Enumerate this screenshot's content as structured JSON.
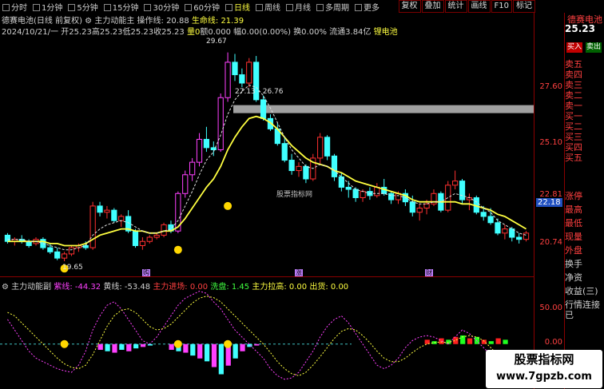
{
  "toolbar": {
    "items": [
      {
        "label": "分时",
        "active": false
      },
      {
        "label": "1分钟",
        "active": false
      },
      {
        "label": "5分钟",
        "active": false
      },
      {
        "label": "15分钟",
        "active": false
      },
      {
        "label": "30分钟",
        "active": false
      },
      {
        "label": "60分钟",
        "active": false
      },
      {
        "label": "日线",
        "active": true
      },
      {
        "label": "周线",
        "active": false
      },
      {
        "label": "月线",
        "active": false
      },
      {
        "label": "多周期",
        "active": false
      },
      {
        "label": "更多",
        "active": false
      }
    ],
    "right_buttons": [
      "复权",
      "叠加",
      "统计",
      "画线",
      "F10",
      "标记"
    ]
  },
  "main_title": {
    "stock": "德赛电池(日线 前复权)",
    "indicator": "主力动能主",
    "op_label": "操作线: 20.88",
    "life_label": "生命线: 21.39"
  },
  "info_line": {
    "date": "2024/10/21/一",
    "open": "开25.23",
    "high": "高25.23",
    "low": "低25.23",
    "close": "收25.23",
    "vol": "量0",
    "amount": "额0.000",
    "pct": "幅0.00(0.00%)",
    "turnover": "换0.00%",
    "float": "流通3.84亿",
    "sector": "锂电池"
  },
  "price_axis": {
    "labels": [
      "27.60",
      "25.10",
      "22.81",
      "20.74"
    ],
    "current": "22.18",
    "sub_labels": [
      "50.00",
      "0.00"
    ]
  },
  "annotations": {
    "high": "29.67",
    "low": "19.65",
    "range": "27.13 - 26.76",
    "watermark": "股票指标网",
    "mark1": "购",
    "mark2": "涨",
    "mark3": "财"
  },
  "sub_panel": {
    "name": "主力动能副",
    "purple": "紫线: -44.32",
    "yellow": "黄线: -53.48",
    "enter": "主力进场: 0.00",
    "wash": "洗盘: 1.45",
    "pull": "主力拉高: 0.00",
    "exit": "出货: 0.00"
  },
  "side_panel": {
    "stock_name": "德赛电池",
    "price": "25.23",
    "buy": "买入",
    "sell": "卖出",
    "order_labels": [
      "卖五",
      "卖四",
      "卖三",
      "卖二",
      "卖一",
      "买一",
      "买二",
      "买三",
      "买四",
      "买五"
    ],
    "stat_labels": [
      "涨停",
      "最高",
      "最低",
      "现量",
      "外盘",
      "换手",
      "净资",
      "收益(三)",
      "行情连接已"
    ]
  },
  "logo": {
    "line1": "股票指标网",
    "line2": "www.7gpzb.com"
  },
  "colors": {
    "up": "#ff3030",
    "down": "#40ffff",
    "line_yellow": "#ffff40",
    "frame": "#8b0000",
    "purple_bar": "#ff40ff"
  },
  "chart_data": {
    "type": "candlestick",
    "y_range": [
      19.0,
      30.5
    ],
    "candles": [
      [
        20.9,
        21.0,
        20.5,
        20.6
      ],
      [
        20.6,
        20.8,
        20.4,
        20.7
      ],
      [
        20.7,
        20.9,
        20.5,
        20.6
      ],
      [
        20.6,
        20.7,
        20.3,
        20.4
      ],
      [
        20.5,
        20.8,
        20.4,
        20.7
      ],
      [
        20.7,
        20.8,
        20.2,
        20.3
      ],
      [
        20.3,
        20.5,
        20.0,
        20.1
      ],
      [
        20.1,
        20.3,
        19.7,
        19.8
      ],
      [
        19.8,
        20.1,
        19.65,
        20.0
      ],
      [
        20.0,
        20.4,
        19.9,
        20.3
      ],
      [
        20.3,
        20.5,
        20.1,
        20.4
      ],
      [
        20.4,
        20.6,
        20.2,
        20.3
      ],
      [
        20.3,
        22.5,
        20.2,
        22.3
      ],
      [
        22.3,
        22.5,
        21.8,
        22.0
      ],
      [
        22.0,
        22.3,
        21.7,
        22.1
      ],
      [
        22.1,
        22.2,
        21.5,
        21.6
      ],
      [
        21.6,
        21.9,
        21.3,
        21.8
      ],
      [
        21.8,
        22.1,
        21.0,
        21.1
      ],
      [
        21.1,
        21.2,
        20.3,
        20.4
      ],
      [
        20.4,
        20.8,
        20.2,
        20.6
      ],
      [
        20.6,
        20.9,
        20.5,
        20.8
      ],
      [
        20.8,
        21.0,
        20.7,
        20.9
      ],
      [
        20.9,
        21.5,
        20.8,
        21.4
      ],
      [
        21.4,
        21.6,
        21.0,
        21.1
      ],
      [
        21.1,
        23.0,
        21.0,
        22.9
      ],
      [
        22.9,
        24.0,
        22.7,
        23.8
      ],
      [
        23.8,
        24.6,
        23.5,
        24.4
      ],
      [
        24.4,
        25.8,
        24.2,
        25.5
      ],
      [
        25.5,
        26.1,
        24.9,
        25.1
      ],
      [
        25.1,
        25.4,
        24.7,
        25.0
      ],
      [
        25.0,
        27.7,
        24.9,
        27.5
      ],
      [
        27.5,
        29.67,
        27.3,
        29.2
      ],
      [
        29.2,
        29.6,
        28.3,
        28.6
      ],
      [
        28.6,
        28.9,
        28.0,
        28.2
      ],
      [
        28.2,
        29.4,
        28.0,
        29.2
      ],
      [
        29.2,
        29.5,
        27.3,
        27.4
      ],
      [
        27.4,
        27.6,
        26.4,
        26.5
      ],
      [
        26.5,
        26.7,
        25.9,
        26.0
      ],
      [
        26.0,
        26.3,
        25.2,
        25.3
      ],
      [
        25.3,
        25.6,
        24.4,
        24.5
      ],
      [
        24.5,
        24.8,
        23.8,
        24.0
      ],
      [
        24.0,
        24.4,
        23.7,
        24.2
      ],
      [
        24.2,
        24.3,
        23.4,
        23.6
      ],
      [
        23.6,
        24.8,
        23.5,
        24.6
      ],
      [
        24.6,
        25.8,
        24.3,
        25.6
      ],
      [
        25.6,
        25.7,
        24.5,
        24.7
      ],
      [
        24.7,
        24.8,
        23.5,
        23.7
      ],
      [
        23.7,
        23.9,
        23.0,
        23.2
      ],
      [
        23.2,
        23.5,
        22.7,
        23.1
      ],
      [
        23.1,
        23.2,
        22.5,
        22.7
      ],
      [
        22.7,
        23.1,
        22.5,
        23.0
      ],
      [
        23.0,
        23.2,
        22.6,
        22.8
      ],
      [
        22.8,
        23.4,
        22.7,
        23.2
      ],
      [
        23.2,
        23.6,
        22.8,
        22.9
      ],
      [
        22.9,
        23.0,
        22.4,
        22.6
      ],
      [
        22.6,
        23.0,
        22.4,
        22.9
      ],
      [
        22.9,
        23.1,
        22.3,
        22.5
      ],
      [
        22.5,
        22.8,
        21.8,
        22.0
      ],
      [
        22.0,
        22.4,
        21.6,
        22.2
      ],
      [
        22.2,
        22.6,
        21.9,
        22.4
      ],
      [
        22.4,
        23.1,
        22.3,
        22.9
      ],
      [
        22.9,
        23.0,
        22.0,
        22.1
      ],
      [
        22.1,
        23.5,
        22.0,
        23.3
      ],
      [
        23.3,
        24.0,
        23.1,
        23.5
      ],
      [
        23.5,
        23.6,
        22.4,
        22.6
      ],
      [
        22.6,
        22.9,
        22.1,
        22.7
      ],
      [
        22.7,
        22.8,
        21.9,
        22.0
      ],
      [
        22.0,
        22.3,
        21.6,
        21.8
      ],
      [
        21.8,
        22.2,
        21.4,
        21.5
      ],
      [
        21.5,
        21.7,
        20.9,
        21.0
      ],
      [
        21.0,
        21.4,
        20.7,
        21.2
      ],
      [
        21.2,
        21.3,
        20.6,
        20.8
      ],
      [
        20.8,
        21.0,
        20.5,
        20.7
      ],
      [
        20.7,
        21.1,
        20.6,
        21.0
      ]
    ],
    "yellow_line": [
      20.6,
      20.6,
      20.6,
      20.6,
      20.6,
      20.6,
      20.5,
      20.5,
      20.4,
      20.4,
      20.4,
      20.5,
      20.7,
      20.9,
      21.0,
      21.1,
      21.2,
      21.2,
      21.1,
      21.1,
      21.0,
      21.0,
      21.1,
      21.1,
      21.3,
      21.7,
      22.2,
      22.7,
      23.2,
      23.6,
      24.2,
      25.0,
      25.6,
      26.1,
      26.5,
      26.6,
      26.5,
      26.3,
      26.0,
      25.6,
      25.2,
      24.9,
      24.6,
      24.4,
      24.3,
      24.2,
      24.0,
      23.9,
      23.7,
      23.5,
      23.4,
      23.3,
      23.2,
      23.1,
      23.0,
      22.9,
      22.8,
      22.6,
      22.5,
      22.5,
      22.5,
      22.5,
      22.5,
      22.5,
      22.4,
      22.4,
      22.3,
      22.2,
      22.1,
      21.9,
      21.8,
      21.6,
      21.4,
      21.2
    ],
    "white_dashed": [
      20.7,
      20.7,
      20.7,
      20.6,
      20.6,
      20.5,
      20.4,
      20.3,
      20.2,
      20.2,
      20.3,
      20.4,
      20.9,
      21.2,
      21.4,
      21.5,
      21.6,
      21.5,
      21.3,
      21.1,
      21.0,
      21.0,
      21.1,
      21.2,
      21.6,
      22.3,
      23.0,
      23.8,
      24.5,
      24.9,
      25.7,
      26.7,
      27.4,
      27.8,
      28.1,
      28.0,
      27.6,
      27.0,
      26.3,
      25.6,
      25.0,
      24.6,
      24.2,
      24.1,
      24.3,
      24.2,
      24.0,
      23.7,
      23.4,
      23.1,
      23.0,
      22.9,
      22.9,
      22.9,
      22.8,
      22.8,
      22.7,
      22.5,
      22.4,
      22.4,
      22.5,
      22.5,
      22.7,
      22.9,
      22.8,
      22.7,
      22.5,
      22.2,
      22.0,
      21.6,
      21.4,
      21.2,
      21.0,
      20.9
    ],
    "sub_purple": [
      35,
      20,
      5,
      -10,
      -20,
      -25,
      -30,
      -35,
      -38,
      -40,
      -30,
      -10,
      20,
      40,
      55,
      60,
      50,
      35,
      20,
      5,
      0,
      10,
      25,
      40,
      55,
      65,
      70,
      75,
      72,
      60,
      50,
      35,
      20,
      10,
      0,
      -10,
      -20,
      -35,
      -45,
      -50,
      -48,
      -40,
      -25,
      -10,
      10,
      25,
      35,
      40,
      30,
      15,
      0,
      -15,
      -30,
      -35,
      -30,
      -20,
      -5,
      5,
      10,
      12,
      10,
      5,
      0,
      10,
      20,
      15,
      5,
      -5,
      -15,
      -25,
      -30,
      -35,
      -40,
      -44
    ],
    "sub_yellow": [
      45,
      40,
      30,
      20,
      10,
      0,
      -10,
      -20,
      -28,
      -33,
      -35,
      -30,
      -15,
      5,
      25,
      40,
      48,
      50,
      45,
      35,
      25,
      20,
      22,
      28,
      38,
      48,
      58,
      65,
      68,
      66,
      60,
      50,
      40,
      30,
      20,
      10,
      0,
      -12,
      -25,
      -35,
      -42,
      -45,
      -40,
      -30,
      -18,
      -5,
      8,
      18,
      22,
      20,
      12,
      2,
      -10,
      -20,
      -25,
      -25,
      -20,
      -12,
      -5,
      0,
      2,
      3,
      2,
      5,
      10,
      12,
      10,
      5,
      -5,
      -15,
      -25,
      -35,
      -45,
      -53
    ],
    "sub_bars": [
      0,
      0,
      0,
      0,
      0,
      0,
      0,
      0,
      0,
      0,
      0,
      0,
      0,
      -8,
      -10,
      -12,
      -8,
      -10,
      -6,
      -4,
      -2,
      0,
      0,
      -8,
      -10,
      -12,
      -16,
      -20,
      -24,
      -32,
      -42,
      -30,
      -20,
      -10,
      -4,
      -2,
      0,
      0,
      0,
      0,
      0,
      0,
      0,
      0,
      0,
      0,
      0,
      0,
      0,
      0,
      0,
      0,
      0,
      0,
      0,
      0,
      0,
      0,
      0,
      6,
      4,
      8,
      6,
      10,
      12,
      8,
      10,
      6,
      4,
      8,
      6,
      0,
      0,
      0
    ]
  }
}
